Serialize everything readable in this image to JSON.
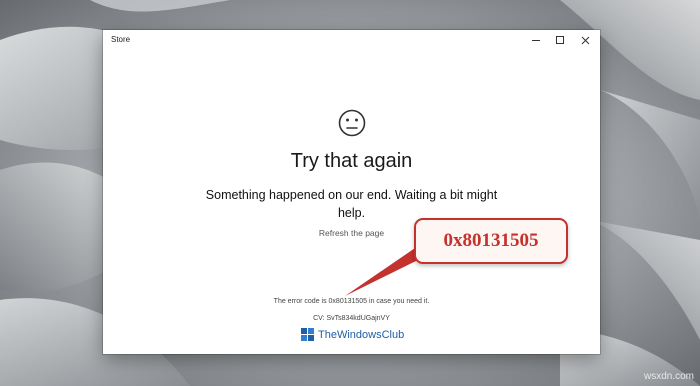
{
  "window": {
    "title": "Store",
    "controls": {
      "minimize": "minimize",
      "maximize": "maximize",
      "close": "close"
    }
  },
  "error": {
    "icon": "sad-face-icon",
    "title": "Try that again",
    "message": "Something happened on our end. Waiting a bit might help.",
    "refresh_label": "Refresh the page",
    "code_line": "The error code is 0x80131505 in case you need it.",
    "cv_line": "CV: SvTs834kdUGajnVY"
  },
  "callout": {
    "text": "0x80131505",
    "color": "#c4322e"
  },
  "watermark": {
    "logo_text": "TheWindowsClub",
    "site": "wsxdn.com"
  },
  "colors": {
    "window_bg": "#ffffff",
    "callout_border": "#c4322e",
    "watermark_blue": "#1f5fa8"
  }
}
